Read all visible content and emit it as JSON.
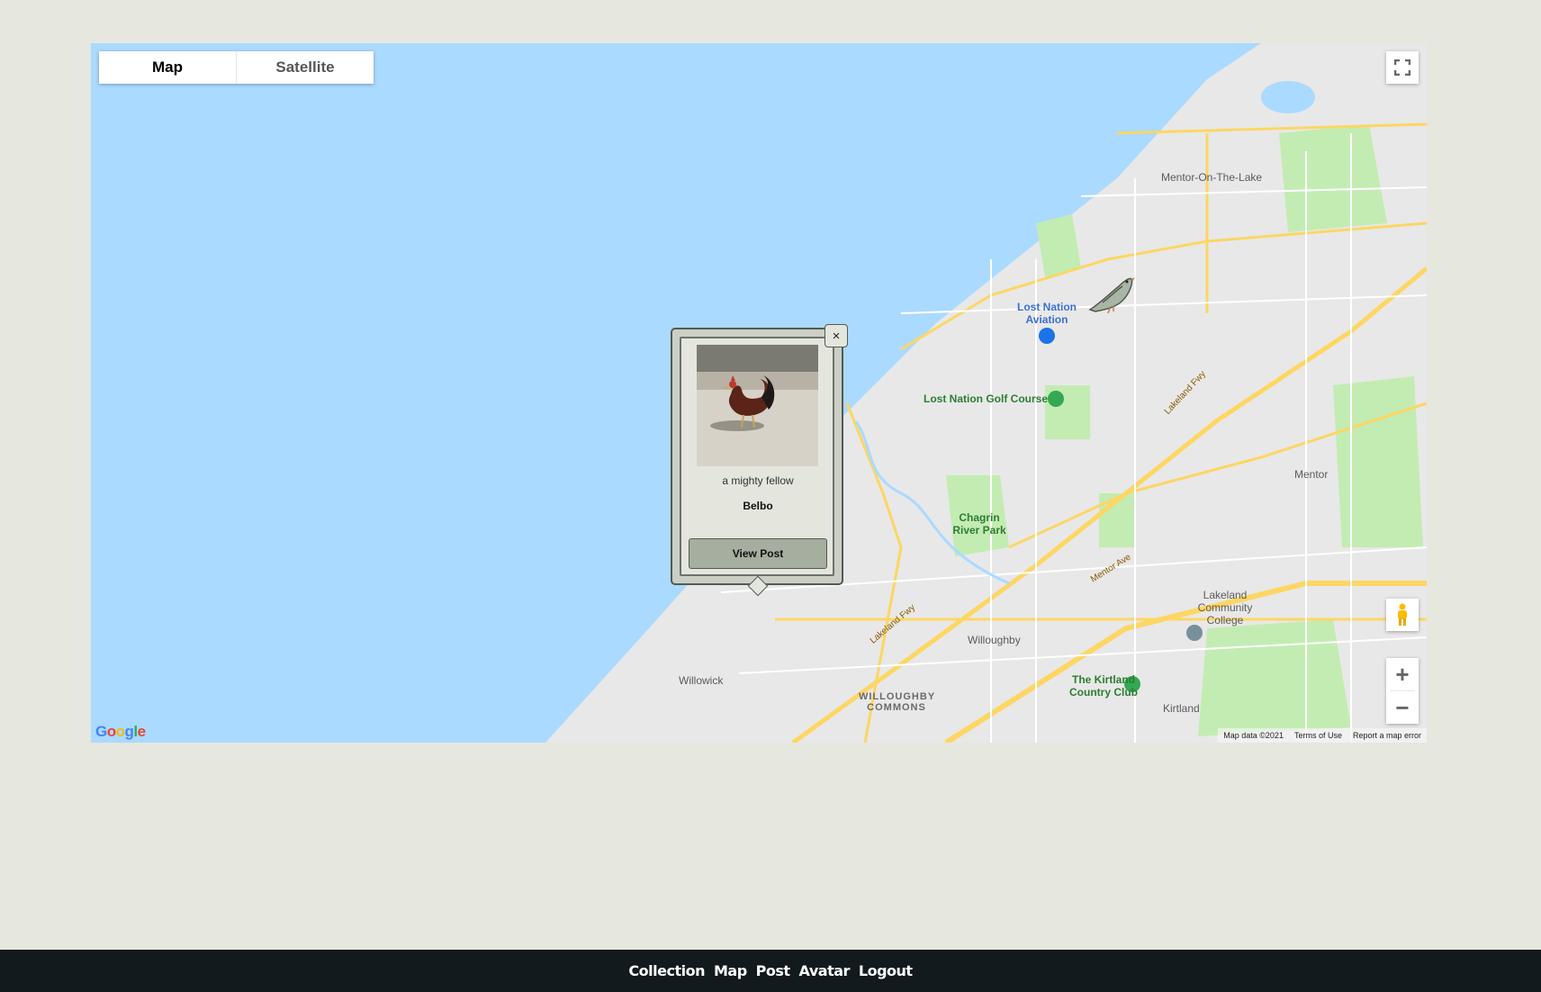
{
  "map": {
    "type_controls": {
      "map_label": "Map",
      "satellite_label": "Satellite"
    },
    "zoom": {
      "in_label": "+",
      "out_label": "−"
    },
    "google_logo": "Google",
    "attribution": {
      "data": "Map data ©2021",
      "terms": "Terms of Use",
      "report": "Report a map error"
    },
    "place_labels": {
      "mentor_on_the_lake": "Mentor-On-The-Lake",
      "lost_nation_aviation": "Lost Nation Aviation",
      "lost_nation_golf": "Lost Nation Golf Course",
      "chagrin_river_park": "Chagrin River Park",
      "mentor": "Mentor",
      "lakeland_college": "Lakeland Community College",
      "willoughby": "Willoughby",
      "willowick": "Willowick",
      "willoughby_commons": "WILLOUGHBY COMMONS",
      "kirtland_club": "The Kirtland Country Club",
      "kirtland": "Kirtland",
      "lakeland_fwy": "Lakeland Fwy",
      "mentor_ave": "Mentor Ave"
    },
    "markers": [
      {
        "icon": "bird-icon"
      }
    ]
  },
  "popup": {
    "caption": "a mighty fellow",
    "name": "Belbo",
    "button_label": "View Post",
    "close_label": "×"
  },
  "footer": {
    "links": [
      "Collection",
      "Map",
      "Post",
      "Avatar",
      "Logout"
    ]
  }
}
